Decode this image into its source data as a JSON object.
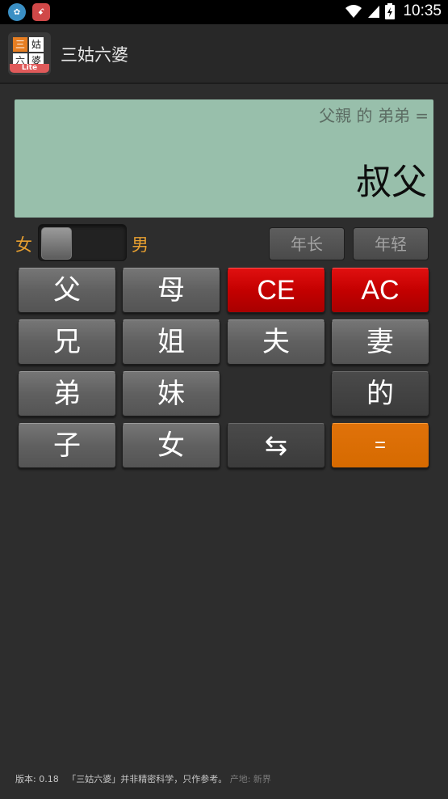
{
  "statusbar": {
    "time": "10:35",
    "notif_a": "✿",
    "notif_b": "ꗃ"
  },
  "app": {
    "title": "三姑六婆",
    "icon_cells": [
      "三",
      "姑",
      "六",
      "婆"
    ],
    "icon_badge": "Lite"
  },
  "display": {
    "expression": "父親 的 弟弟 =",
    "result": "叔父"
  },
  "gender": {
    "left_label": "女",
    "right_label": "男"
  },
  "age": {
    "older": "年长",
    "younger": "年轻"
  },
  "keys": {
    "father": "父",
    "mother": "母",
    "ce": "CE",
    "ac": "AC",
    "older_brother": "兄",
    "older_sister": "姐",
    "husband": "夫",
    "wife": "妻",
    "younger_brother": "弟",
    "younger_sister": "妹",
    "of": "的",
    "son": "子",
    "daughter": "女",
    "swap": "⇆",
    "equals": "="
  },
  "footer": {
    "version": "版本: 0.18",
    "disclaimer": "「三姑六婆」并非精密科学，只作参考。",
    "origin": "产地: 新界"
  },
  "colors": {
    "display_bg": "#98bfab",
    "accent_orange": "#e8a030",
    "red_key": "#c40000",
    "orange_key": "#d66a00"
  }
}
